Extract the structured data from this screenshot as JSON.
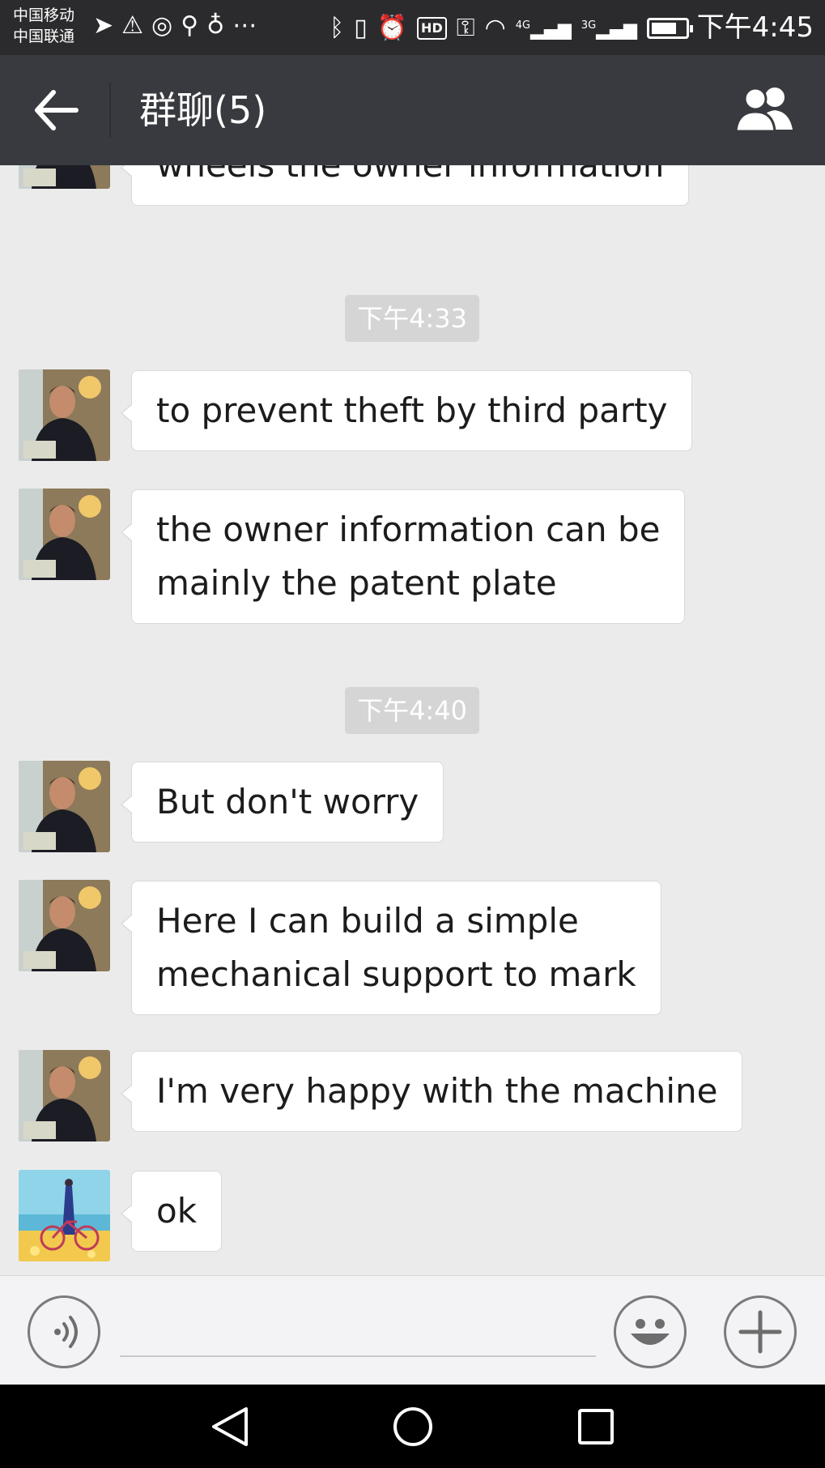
{
  "status_bar": {
    "carrier_1": "中国移动",
    "carrier_2": "中国联通",
    "signal_4g_label": "4G",
    "signal_3g_label": "3G",
    "hd_label": "HD",
    "time": "下午4:45"
  },
  "title_bar": {
    "title": "群聊(5)",
    "back_icon": "arrow-left-icon",
    "members_icon": "group-members-icon"
  },
  "messages": [
    {
      "type": "text",
      "sender": "man-in-suit-avatar",
      "text": "wheels the owner information"
    },
    {
      "type": "time",
      "text": "下午4:33"
    },
    {
      "type": "text",
      "sender": "man-in-suit-avatar",
      "text": "to prevent theft by third party"
    },
    {
      "type": "text",
      "sender": "man-in-suit-avatar",
      "lines": [
        "the owner information can be",
        "mainly the patent plate"
      ]
    },
    {
      "type": "time",
      "text": "下午4:40"
    },
    {
      "type": "text",
      "sender": "man-in-suit-avatar",
      "text": "But don't worry"
    },
    {
      "type": "text",
      "sender": "man-in-suit-avatar",
      "lines": [
        "Here I can build a simple",
        "mechanical support to mark"
      ]
    },
    {
      "type": "text",
      "sender": "man-in-suit-avatar",
      "text": "I'm very happy with the machine"
    },
    {
      "type": "text",
      "sender": "beach-bicycle-avatar",
      "text": "ok"
    }
  ],
  "input_bar": {
    "voice_icon": "voice-input-icon",
    "emoji_icon": "smiley-emoji-icon",
    "plus_icon": "plus-icon",
    "input_value": ""
  },
  "nav_bar": {
    "back_icon": "triangle-back-icon",
    "home_icon": "circle-home-icon",
    "recent_icon": "square-recents-icon"
  },
  "colors": {
    "title_bar_bg": "#393a3f",
    "status_bar_bg": "#2b2b2d",
    "chat_bg": "#ebebeb",
    "bubble_bg": "#ffffff",
    "timestamp_bg": "#d5d5d5"
  }
}
